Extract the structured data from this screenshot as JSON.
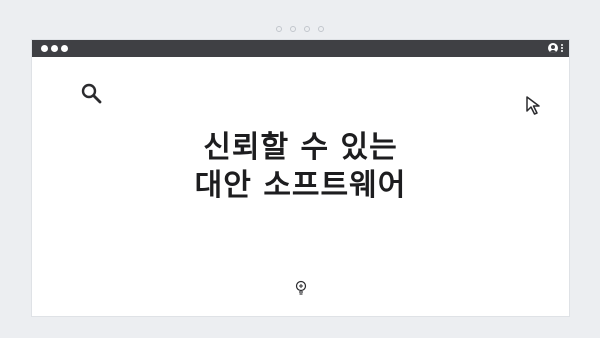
{
  "pager": {
    "count": 4
  },
  "window": {
    "titlebar": {
      "controls": [
        "window-dot",
        "window-dot",
        "window-dot"
      ],
      "right_icons": [
        "user-icon",
        "kebab-menu-icon"
      ]
    },
    "content": {
      "heading_lines": [
        "신뢰할 수 있는",
        "대안 소프트웨어"
      ],
      "icons": [
        "search-icon",
        "cursor-icon",
        "lightbulb-icon"
      ]
    }
  },
  "colors": {
    "background": "#eceef1",
    "titlebar": "#3f4044",
    "window": "#ffffff",
    "text": "#1d1d1f"
  }
}
